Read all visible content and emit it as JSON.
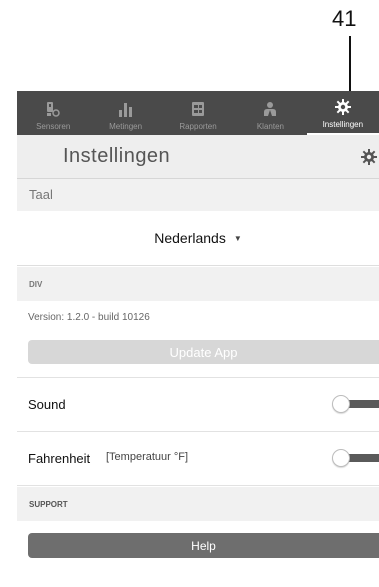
{
  "callout": {
    "number": "41"
  },
  "tabs": [
    {
      "label": "Sensoren",
      "icon": "sensor-icon",
      "active": false
    },
    {
      "label": "Metingen",
      "icon": "bar-chart-icon",
      "active": false
    },
    {
      "label": "Rapporten",
      "icon": "report-icon",
      "active": false
    },
    {
      "label": "Klanten",
      "icon": "users-icon",
      "active": false
    },
    {
      "label": "Instellingen",
      "icon": "gear-icon",
      "active": true
    }
  ],
  "header": {
    "title": "Instellingen",
    "icon": "gear-icon"
  },
  "language": {
    "section_title": "Taal",
    "selected": "Nederlands"
  },
  "div_section": {
    "title": "DIV",
    "version": "Version: 1.2.0 - build 10126",
    "update_label": "Update App"
  },
  "settings": {
    "sound": {
      "label": "Sound",
      "on": false
    },
    "fahrenheit": {
      "label": "Fahrenheit",
      "sublabel": "[Temperatuur °F]",
      "on": false
    }
  },
  "support": {
    "title": "SUPPORT",
    "help_label": "Help"
  },
  "colors": {
    "tabbar": "#4a4a4a",
    "active_tab": "#ffffff",
    "help_button": "#6e6e6e",
    "update_button": "#d7d7d7"
  }
}
